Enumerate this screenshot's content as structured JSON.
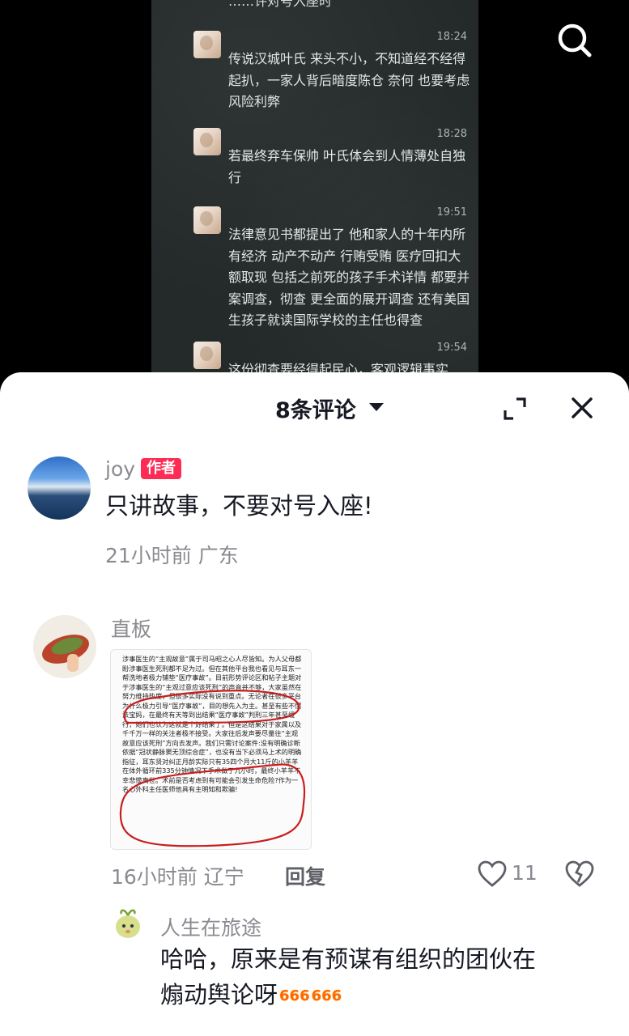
{
  "background": {
    "top_fragment": "……许对号入座时",
    "messages": [
      {
        "time": "18:24",
        "text": "传说汉城叶氏 来头不小，不知道经不经得起扒，一家人背后暗度陈仓 奈何  也要考虑风险利弊"
      },
      {
        "time": "18:28",
        "text": "若最终弃车保帅 叶氏体会到人情薄处自独行"
      },
      {
        "time": "19:51",
        "text": "法律意见书都提出了 他和家人的十年内所有经济 动产不动产 行贿受贿 医疗回扣大额取现 包括之前死的孩子手术详情 都要并案调查，彻查 更全面的展开调查 还有美国生孩子就读国际学校的主任也得查"
      },
      {
        "time": "19:54",
        "text": "这份彻查要经得起民心，客观逻辑事实"
      }
    ],
    "search_icon": "search-icon"
  },
  "sheet": {
    "title": "8条评论",
    "expand_icon": "expand-icon",
    "close_icon": "close-icon"
  },
  "comments": [
    {
      "user": "joy",
      "badge": "作者",
      "text": "只讲故事，不要对号入座!",
      "meta": "21小时前 广东"
    },
    {
      "user": "直板",
      "image_text": "涉事医生的“主观故意”属于司马昭之心人尽皆知。为人父母都盼涉事医生死刑都不足为过。但在其他平台我也看见与耳东一帮洗地者极力铺垫“医疗事故”。目前形势评论区和帖子主题对于涉事医生的“主观过意应该死刑”的声音并不够，大家虽然在努力维持热度，但很多实际没有说到重点。无论者在很多平台为什么极力引导“医疗事故”，目的想先入为主。甚至有些不懂法宝妈，在最终有天等到出结果“医疗事故”判刑三年甚至缓行，她们也认为这就是个好结果了。但是这结果对于家属以及千千万一样的关注者极不接受。大家往后发声要尽量往“主观故意应该死刑”方向去发声。我们只需讨论案件:没有明确诊断依据“冠状静脉窦无顶综合症”，也没有当下必须马上术的明确指征，耳东贤对纠正月龄实际只有35四个月大11斤的小羊羊在体外循环前335分钟情况下手术做了九小时，最终小羊羊不幸悲惨离世。术前是否考虑到有可能会引发生命危险?作为一名心外科主任医师他具有主明知和欺骗!",
      "meta": "16小时前 辽宁",
      "reply_label": "回复",
      "like_count": "11"
    },
    {
      "user": "人生在旅途",
      "text_line1": "哈哈，原来是有预谋有组织的团伙在",
      "text_line2": "煽动舆论呀",
      "emoji": "666"
    }
  ]
}
